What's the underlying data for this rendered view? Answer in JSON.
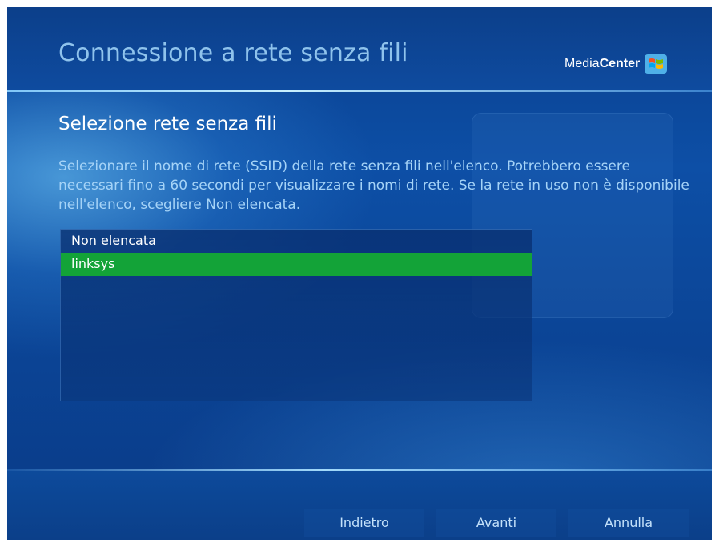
{
  "header": {
    "title": "Connessione a rete senza fili",
    "brand_media": "Media",
    "brand_center": "Center"
  },
  "main": {
    "title": "Selezione rete senza fili",
    "instructions": "Selezionare il nome di rete (SSID) della rete senza fili nell'elenco. Potrebbero essere necessari fino a 60 secondi per visualizzare i nomi di rete. Se la rete in uso non è disponibile nell'elenco, scegliere Non elencata.",
    "networks": [
      {
        "label": "Non elencata",
        "selected": false
      },
      {
        "label": "linksys",
        "selected": true
      }
    ]
  },
  "footer": {
    "back_label": "Indietro",
    "next_label": "Avanti",
    "cancel_label": "Annulla"
  },
  "icons": {
    "brand_logo": "windows-flag-icon"
  },
  "colors": {
    "selection": "#13a338",
    "title_text": "#8fc3ec",
    "body_text": "#a5d3f7"
  }
}
